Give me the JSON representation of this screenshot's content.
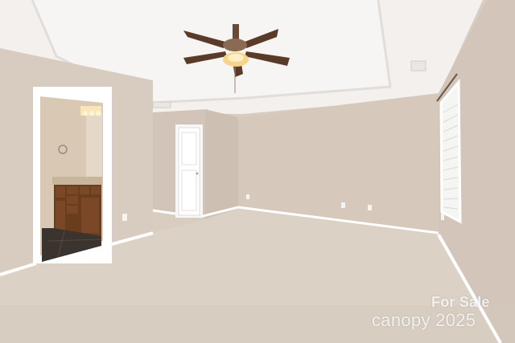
{
  "watermark": {
    "line1": "For Sale",
    "line2": "canopy 2025"
  },
  "colors": {
    "wall_left": "#d8cbbf",
    "wall_back": "#d7c9bc",
    "wall_right": "#d4c6ba",
    "ceiling": "#f2efec",
    "carpet": "#d9cfc2",
    "trim": "#ffffff",
    "cabinet": "#6b3d1f",
    "floor_tile": "#3a332e",
    "fan_blade": "#5a3a28",
    "fan_light": "#f6d58a"
  },
  "icons": {
    "ceiling_fan": "ceiling-fan-icon",
    "window": "window-icon",
    "door": "door-icon"
  }
}
